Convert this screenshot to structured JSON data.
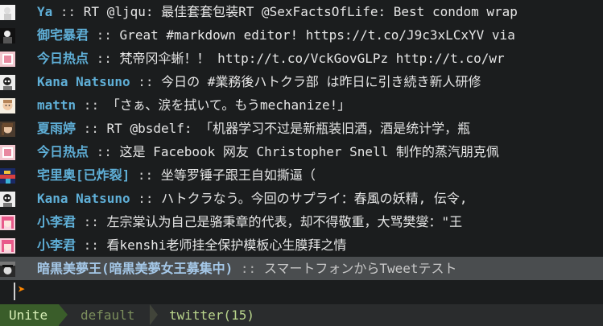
{
  "tweets": [
    {
      "user": "Ya",
      "sep": " :: ",
      "text": "RT @ljqu: 最佳套套包装RT @SexFactsOfLife: Best condom wrap",
      "avatar": "avatar-white-figure"
    },
    {
      "user": "御宅暴君",
      "sep": " :: ",
      "text": "Great #markdown editor! https://t.co/J9c3xLCxYV via",
      "avatar": "avatar-black-figure"
    },
    {
      "user": "今日热点",
      "sep": " :: ",
      "text": "梵帝冈伞蜥！！ http://t.co/VckGovGLPz http://t.co/wr",
      "avatar": "avatar-pink-card"
    },
    {
      "user": "Kana Natsuno",
      "sep": " :: ",
      "text": "今日の #業務後ハトクラ部 は昨日に引き続き新人研修",
      "avatar": "avatar-mono-character"
    },
    {
      "user": "mattn",
      "sep": " :: ",
      "text": "「さぁ、涙を拭いて。もうmechanize!」",
      "avatar": "avatar-face"
    },
    {
      "user": "夏雨婷",
      "sep": " :: ",
      "text": "RT @bsdelf: 「机器学习不过是新瓶装旧酒，酒是统计学，瓶",
      "avatar": "avatar-girl-portrait"
    },
    {
      "user": "今日热点",
      "sep": " :: ",
      "text": "这是 Facebook 网友 Christopher Snell 制作的蒸汽朋克佩",
      "avatar": "avatar-pink-card"
    },
    {
      "user": "宅里奥[已炸裂]",
      "sep": " :: ",
      "text": "坐等罗锤子跟王自如撕逼（",
      "avatar": "avatar-colorful"
    },
    {
      "user": "Kana Natsuno",
      "sep": " :: ",
      "text": "ハトクラなう。今回のサプライ：春風の妖精, 伝令,",
      "avatar": "avatar-mono-character"
    },
    {
      "user": "小李君",
      "sep": " :: ",
      "text": "左宗棠认为自己是骆秉章的代表，却不得敬重，大骂樊燮：\"王",
      "avatar": "avatar-pink-anime"
    },
    {
      "user": "小李君",
      "sep": " :: ",
      "text": "看kenshi老师挂全保护模板心生膜拜之情",
      "avatar": "avatar-pink-anime"
    },
    {
      "user": "暗黒美夢王(暗黒美夢女王募集中)",
      "sep": " :: ",
      "text": "スマートフォンからTweetテスト",
      "avatar": "avatar-dark-anime",
      "selected": true
    }
  ],
  "prompt": {
    "symbol": "➤"
  },
  "statusbar": {
    "mode": "Unite",
    "source": "default",
    "buffer": "twitter(15)"
  },
  "colors": {
    "background": "#1b1d1e",
    "user": "#5fafd7",
    "prompt": "#ff8700",
    "mode_bg": "#3a5d2a",
    "selected_bg": "#4a4d4f"
  }
}
